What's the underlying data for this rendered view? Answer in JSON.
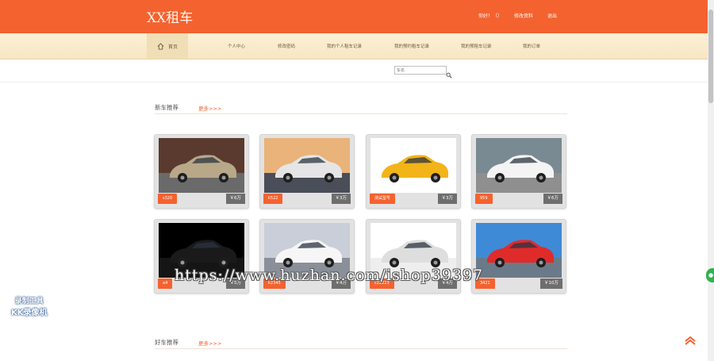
{
  "header": {
    "brand": "XX租车",
    "links": [
      "你好！（）",
      "修改资料",
      "退出"
    ]
  },
  "nav": {
    "home": "首页",
    "items": [
      "个人中心",
      "修改密码",
      "我的个人租车记录",
      "我的预约租车记录",
      "我的预租车记录",
      "我的订单"
    ]
  },
  "search": {
    "placeholder": "车名"
  },
  "sections": [
    {
      "title": "新车推荐",
      "more": "更多>>>"
    },
    {
      "title": "好车推荐",
      "more": "更多>>>"
    }
  ],
  "cars": [
    {
      "tag": "s320",
      "price": "￥6万",
      "colors": {
        "sky": "#5a3a2e",
        "ground": "#6a6a6a",
        "body": "#b8a888"
      }
    },
    {
      "tag": "k522",
      "price": "￥3万",
      "colors": {
        "sky": "#e9b37a",
        "ground": "#4a4e58",
        "body": "#e5e5e5"
      }
    },
    {
      "tag": "测试型号",
      "price": "￥3万",
      "colors": {
        "sky": "#ffffff",
        "ground": "#ffffff",
        "body": "#f2b418"
      }
    },
    {
      "tag": "959",
      "price": "￥6万",
      "colors": {
        "sky": "#7a8a92",
        "ground": "#8f8f8f",
        "body": "#f4f4f4"
      }
    },
    {
      "tag": "a4",
      "price": "￥5万",
      "colors": {
        "sky": "#000000",
        "ground": "#151515",
        "body": "#1a1a1a"
      }
    },
    {
      "tag": "k2345",
      "price": "￥4万",
      "colors": {
        "sky": "#c9ced8",
        "ground": "#8a8f99",
        "body": "#f6f6f6"
      }
    },
    {
      "tag": "c22223",
      "price": "￥4万",
      "colors": {
        "sky": "#ffffff",
        "ground": "#eeeeee",
        "body": "#dedede"
      }
    },
    {
      "tag": "3421",
      "price": "￥10万",
      "colors": {
        "sky": "#3f8ad6",
        "ground": "#6b7a88",
        "body": "#e02b2b"
      }
    }
  ],
  "overlay": {
    "watermark": "https://www.huzhan.com/ishop39397",
    "recorder_line1": "录制工具",
    "recorder_line2": "KK录像机"
  },
  "accent_color": "#f4622f"
}
